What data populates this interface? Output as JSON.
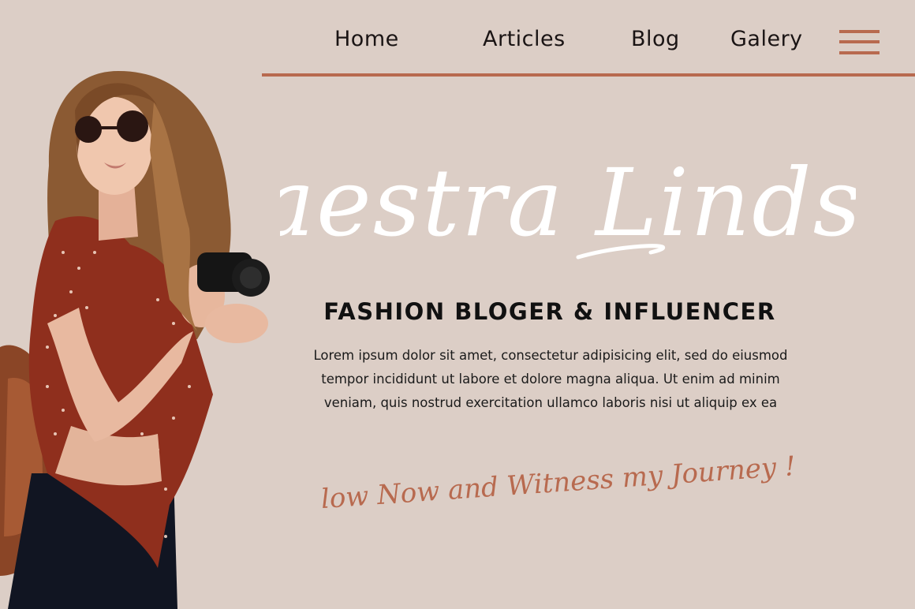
{
  "nav": {
    "items": [
      {
        "label": "Home"
      },
      {
        "label": "Articles"
      },
      {
        "label": "Blog"
      },
      {
        "label": "Galery"
      }
    ],
    "menu_icon": "hamburger-menu-icon"
  },
  "hero": {
    "name": "Maestra Lindsay",
    "subtitle": "FASHION BLOGER & INFLUENCER",
    "body": "Lorem ipsum dolor sit amet, consectetur adipisicing elit, sed do eiusmod tempor incididunt ut labore et dolore magna aliqua. Ut enim ad minim veniam, quis nostrud exercitation ullamco laboris nisi ut aliquip ex ea",
    "tagline": "Follow Now and Witness my Journey !!!"
  },
  "colors": {
    "background": "#dccec6",
    "accent": "#b86a4f",
    "title": "#ffffff",
    "text": "#111111"
  }
}
